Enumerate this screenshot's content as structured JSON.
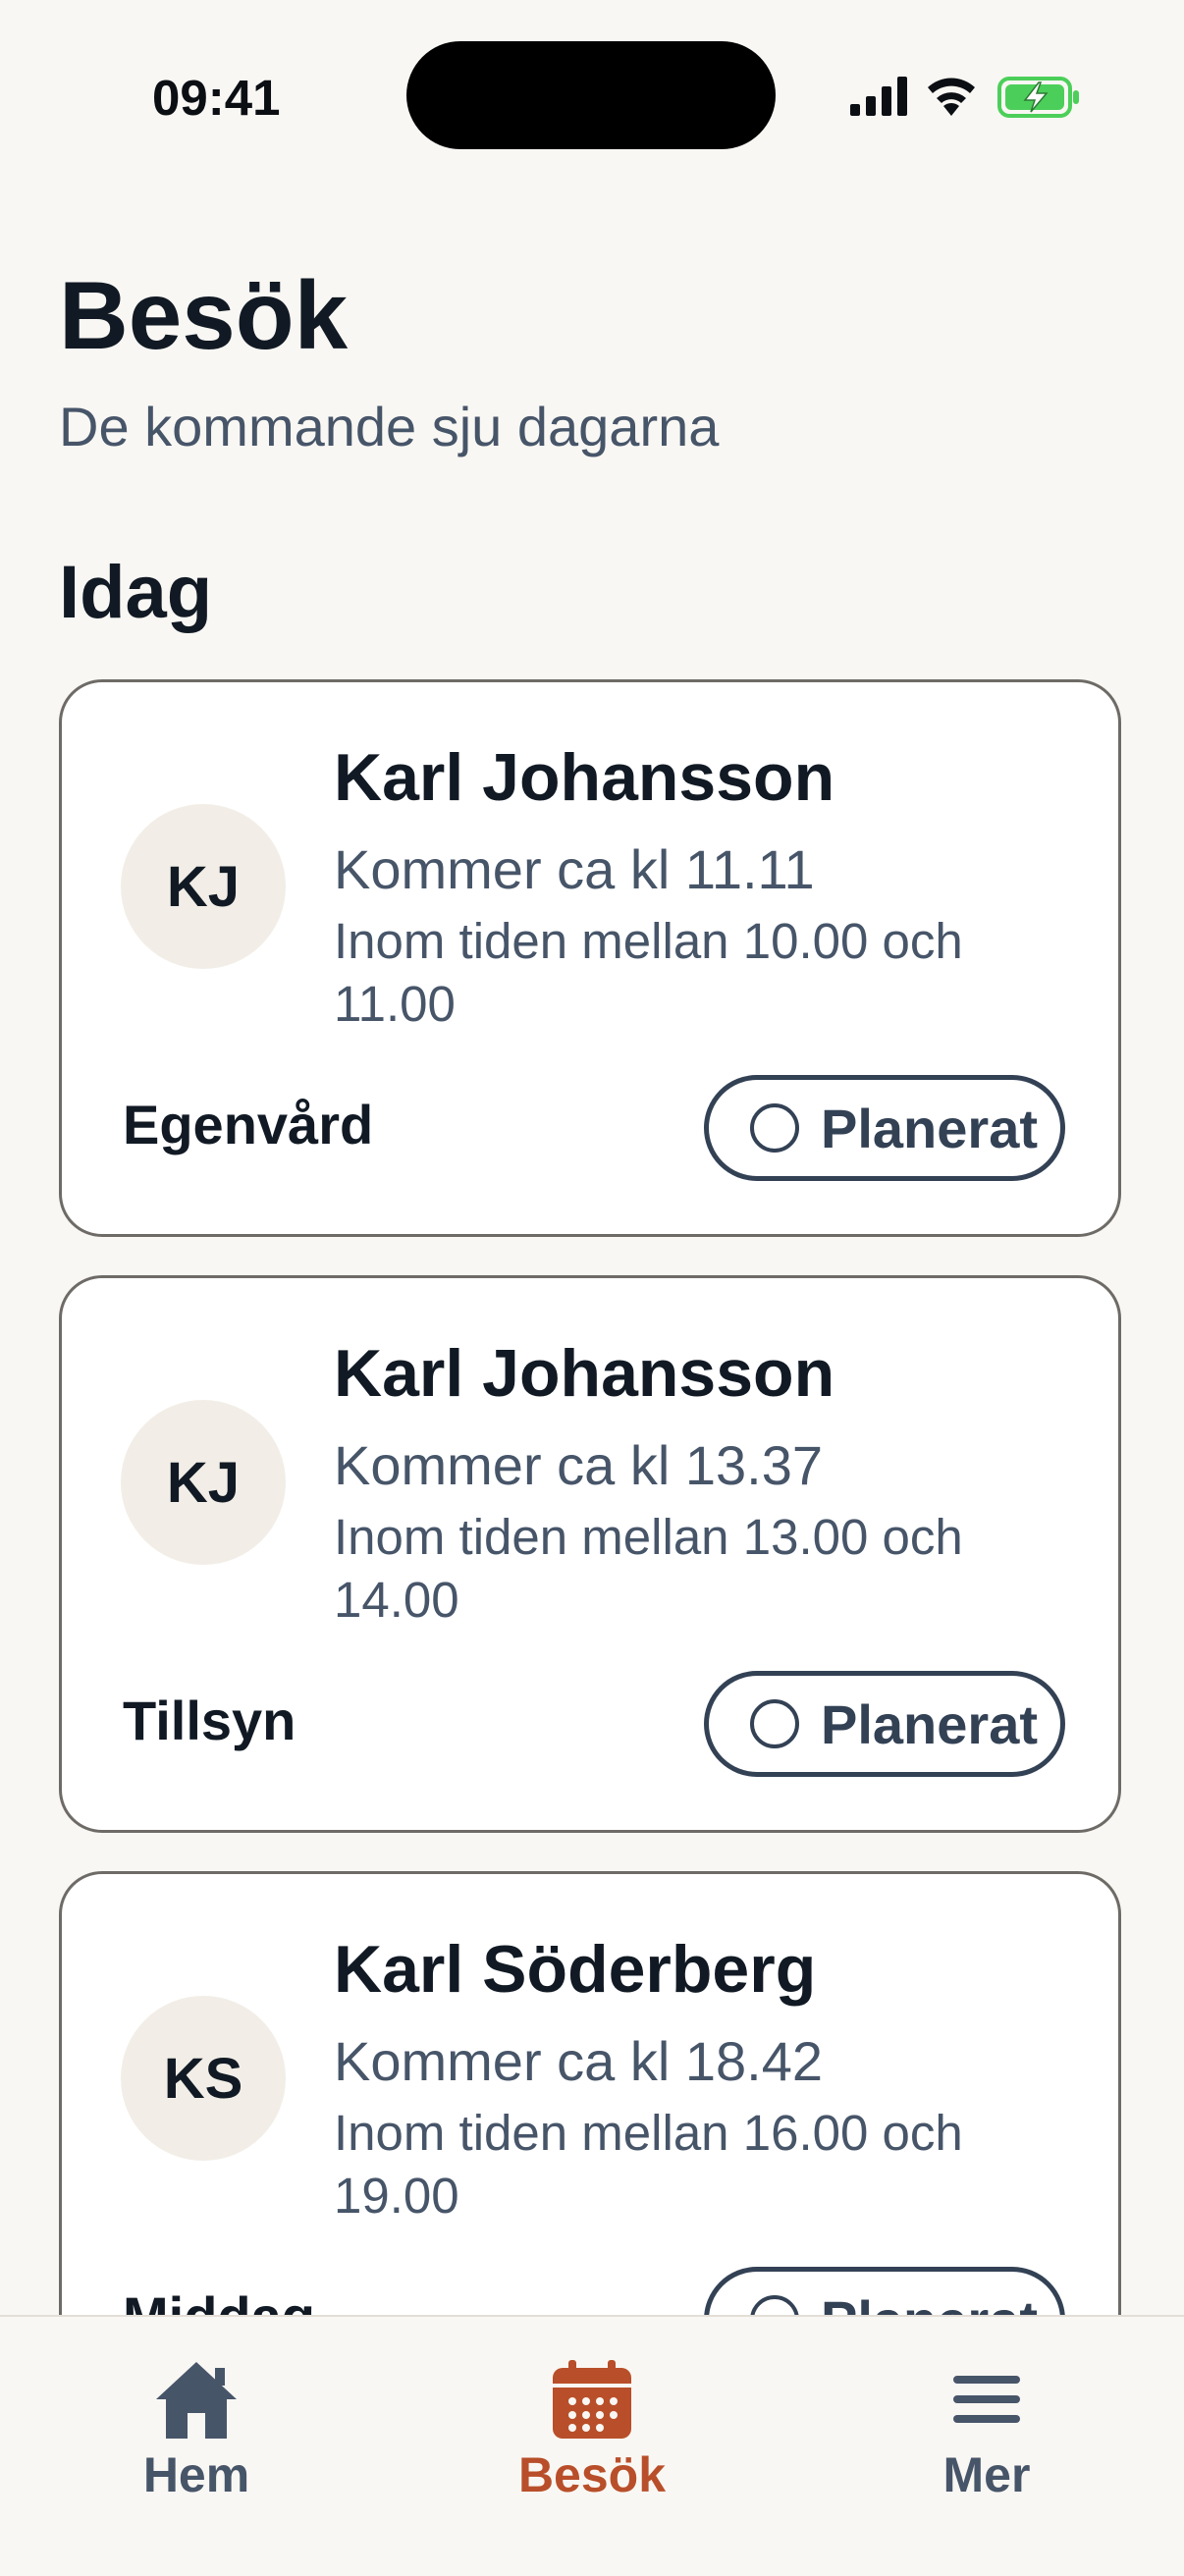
{
  "status_bar": {
    "time": "09:41"
  },
  "header": {
    "title": "Besök",
    "subtitle": "De kommande sju dagarna"
  },
  "section": {
    "title": "Idag"
  },
  "visits": [
    {
      "initials": "KJ",
      "name": "Karl Johansson",
      "eta": "Kommer ca kl 11.11",
      "window": "Inom tiden mellan 10.00 och 11.00",
      "type": "Egenvård",
      "status": "Planerat"
    },
    {
      "initials": "KJ",
      "name": "Karl Johansson",
      "eta": "Kommer ca kl 13.37",
      "window": "Inom tiden mellan 13.00 och 14.00",
      "type": "Tillsyn",
      "status": "Planerat"
    },
    {
      "initials": "KS",
      "name": "Karl Söderberg",
      "eta": "Kommer ca kl 18.42",
      "window": "Inom tiden mellan 16.00 och 19.00",
      "type": "Middag",
      "status": "Planerat"
    }
  ],
  "tabbar": {
    "items": [
      {
        "label": "Hem",
        "icon": "home-icon"
      },
      {
        "label": "Besök",
        "icon": "calendar-icon",
        "active": true
      },
      {
        "label": "Mer",
        "icon": "menu-icon"
      }
    ]
  },
  "colors": {
    "accent": "#b84f2a",
    "text": "#111a24",
    "muted": "#475569",
    "background": "#f9f7f3"
  }
}
